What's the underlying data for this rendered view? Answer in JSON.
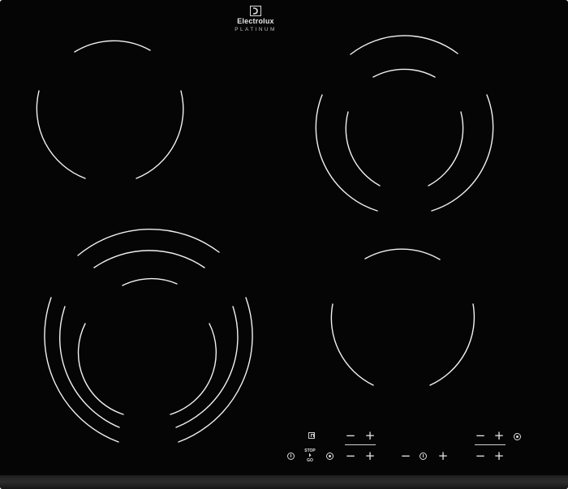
{
  "brand": {
    "name": "Electrolux",
    "line": "PLATINUM"
  },
  "controls": {
    "minus": "−",
    "plus": "+",
    "stop_go_line1": "STOP",
    "stop_go_line2": "GO"
  },
  "colors": {
    "glass": "#050505",
    "zone_line": "#ffffff",
    "edge": "#2a2a2a"
  }
}
